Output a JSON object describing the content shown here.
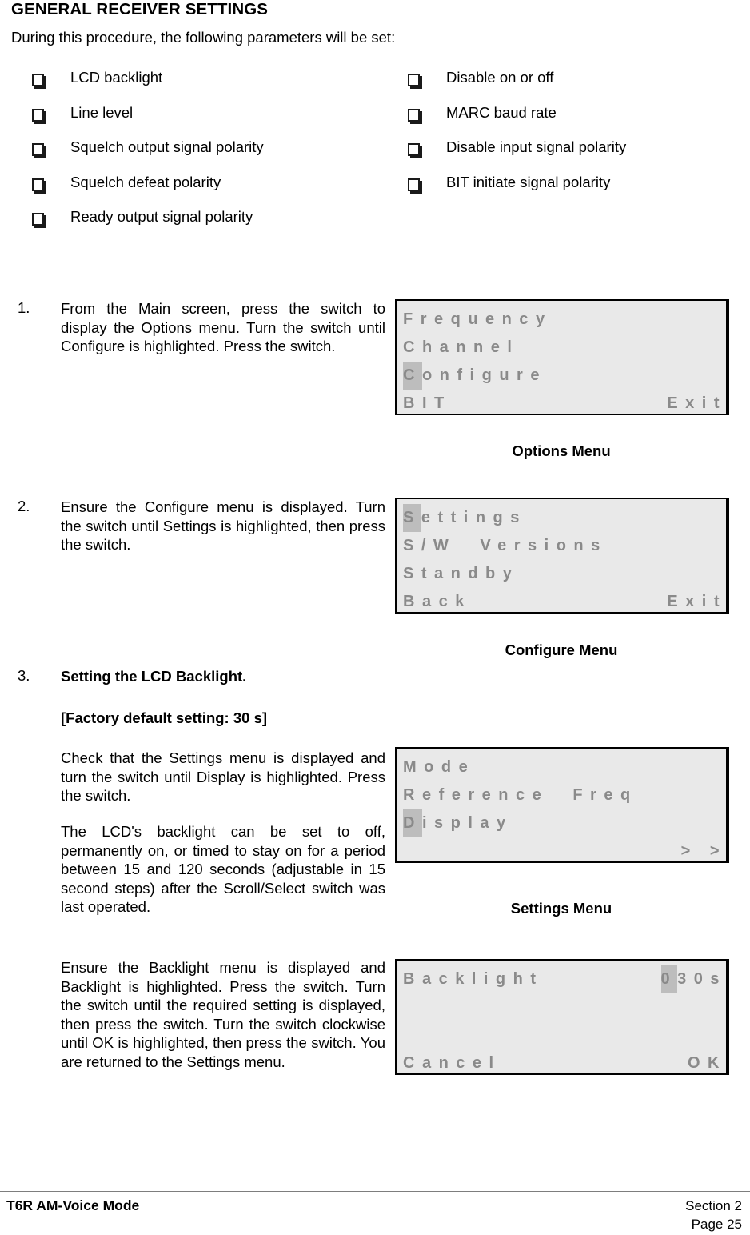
{
  "document": {
    "title": "GENERAL RECEIVER SETTINGS",
    "intro": "During this procedure, the following parameters will be set:"
  },
  "parameters": {
    "left_column": [
      {
        "label": "LCD backlight"
      },
      {
        "label": "Line level"
      },
      {
        "label": "Squelch output signal polarity"
      },
      {
        "label": "Squelch defeat polarity"
      },
      {
        "label": "Ready output signal polarity"
      }
    ],
    "right_column": [
      {
        "label": "Disable on or off"
      },
      {
        "label": "MARC baud rate"
      },
      {
        "label": "Disable input signal polarity"
      },
      {
        "label": "BIT initiate signal polarity"
      }
    ]
  },
  "steps": {
    "step1": {
      "number": "1.",
      "text": "From the Main screen, press the switch to display the Options menu. Turn the switch until Configure is highlighted. Press the switch."
    },
    "step2": {
      "number": "2.",
      "text": "Ensure the Configure menu is displayed. Turn the switch until Settings is highlighted, then press the switch."
    },
    "step3": {
      "number": "3.",
      "heading": "Setting the LCD Backlight.",
      "default_note": "[Factory default setting:  30 s]",
      "para1": "Check that the Settings menu is displayed and  turn the switch until Display is highlighted. Press the switch.",
      "para2": "The LCD's backlight can be set to off, permanently on, or timed to stay on for a period between 15 and 120 seconds (adjustable in 15 second steps) after the Scroll/Select switch was last operated.",
      "para3": "Ensure the Backlight menu is displayed and Backlight is highlighted. Press the switch. Turn the switch until the required setting is displayed, then press the switch. Turn the switch clockwise until OK is highlighted, then press the switch. You are returned to the Settings menu."
    }
  },
  "lcd_panels": [
    {
      "id": "options-menu",
      "caption": "Options Menu",
      "rows": [
        {
          "left": "Frequency",
          "right": "",
          "highlight": ""
        },
        {
          "left": "Channel",
          "right": "",
          "highlight": ""
        },
        {
          "left": "Configure",
          "right": "",
          "highlight": "C"
        },
        {
          "left": "BIT",
          "right": "Exit",
          "highlight": ""
        }
      ]
    },
    {
      "id": "configure-menu",
      "caption": "Configure Menu",
      "rows": [
        {
          "left": "Settings",
          "right": "",
          "highlight": "S"
        },
        {
          "left": "S/W  Versions",
          "right": "",
          "highlight": ""
        },
        {
          "left": "Standby",
          "right": "",
          "highlight": ""
        },
        {
          "left": "Back",
          "right": "Exit",
          "highlight": ""
        }
      ]
    },
    {
      "id": "settings-menu",
      "caption": "Settings Menu",
      "rows": [
        {
          "left": "Mode",
          "right": "",
          "highlight": ""
        },
        {
          "left": "Reference  Freq",
          "right": "",
          "highlight": ""
        },
        {
          "left": "Display",
          "right": "",
          "highlight": "D"
        },
        {
          "left": "",
          "right": "> >",
          "highlight": ""
        }
      ]
    },
    {
      "id": "backlight-menu",
      "caption": "",
      "rows": [
        {
          "left": "Backlight",
          "right": "030s",
          "highlight_right": "0"
        },
        {
          "left": "",
          "right": "",
          "highlight": ""
        },
        {
          "left": "",
          "right": "",
          "highlight": ""
        },
        {
          "left": "Cancel",
          "right": "OK",
          "highlight": ""
        }
      ]
    }
  ],
  "footer": {
    "left": "T6R AM-Voice Mode",
    "section": "Section 2",
    "page": "Page 25"
  },
  "colors": {
    "lcd_background": "#e9e9e9",
    "lcd_text": "#8a8a8a",
    "lcd_highlight": "#bdbdbd",
    "page_background": "#ffffff",
    "text": "#000000"
  }
}
